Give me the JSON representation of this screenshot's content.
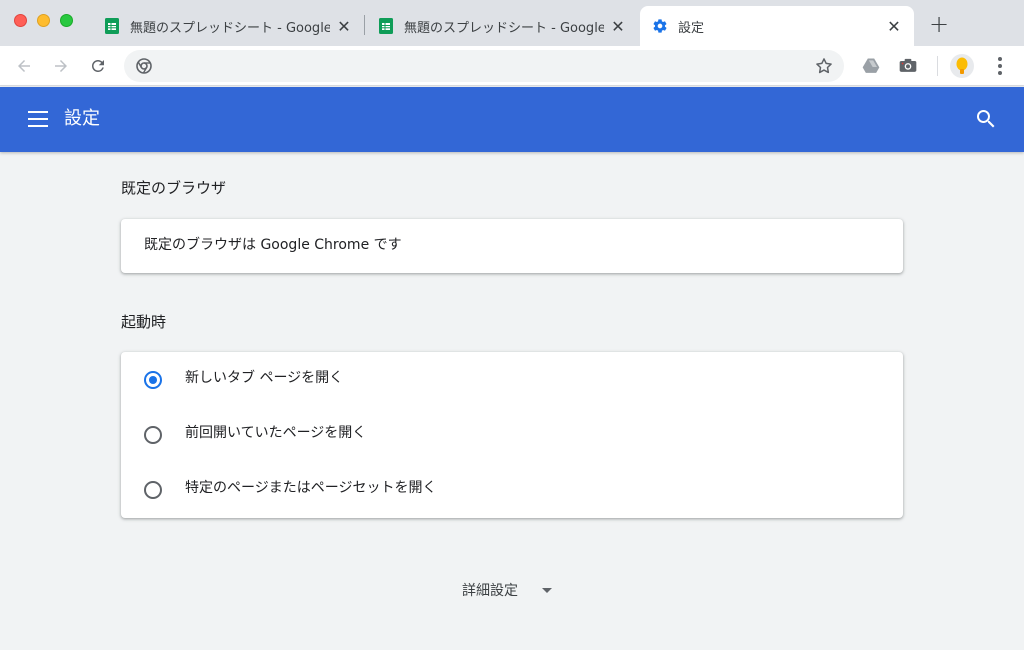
{
  "tabs": [
    {
      "title": "無題のスプレッドシート - Google",
      "icon": "sheets-icon",
      "active": false
    },
    {
      "title": "無題のスプレッドシート - Google",
      "icon": "sheets-icon",
      "active": false
    },
    {
      "title": "設定",
      "icon": "settings-gear-icon",
      "active": true
    }
  ],
  "toolbar": {
    "url": ""
  },
  "header": {
    "title": "設定",
    "color": "#3367d6"
  },
  "default_browser": {
    "section_title": "既定のブラウザ",
    "status_text": "既定のブラウザは Google Chrome です"
  },
  "startup": {
    "section_title": "起動時",
    "options": [
      {
        "label": "新しいタブ ページを開く",
        "selected": true
      },
      {
        "label": "前回開いていたページを開く",
        "selected": false
      },
      {
        "label": "特定のページまたはページセットを開く",
        "selected": false
      }
    ]
  },
  "advanced": {
    "label": "詳細設定"
  },
  "colors": {
    "accent": "#1a73e8",
    "sheets_green": "#0f9d58"
  }
}
